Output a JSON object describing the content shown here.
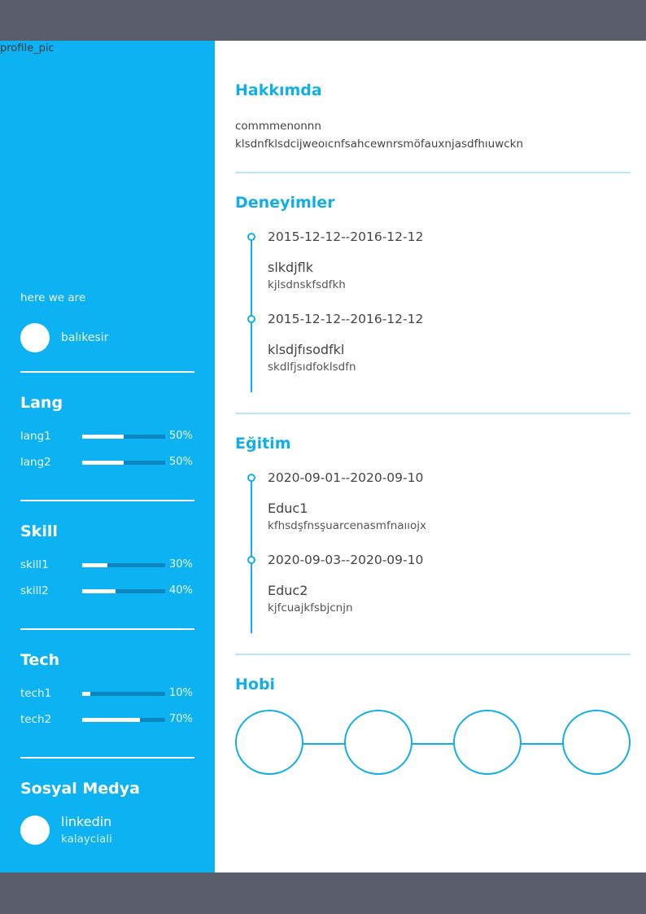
{
  "sidebar": {
    "profile_pic_label": "profile_pic",
    "tagline": "here we are",
    "location": "balıkesir",
    "lang": {
      "title": "Lang",
      "items": [
        {
          "name": "lang1",
          "percent_label": "50%",
          "percent": 50
        },
        {
          "name": "lang2",
          "percent_label": "50%",
          "percent": 50
        }
      ]
    },
    "skill": {
      "title": "Skill",
      "items": [
        {
          "name": "skill1",
          "percent_label": "30%",
          "percent": 30
        },
        {
          "name": "skill2",
          "percent_label": "40%",
          "percent": 40
        }
      ]
    },
    "tech": {
      "title": "Tech",
      "items": [
        {
          "name": "tech1",
          "percent_label": "10%",
          "percent": 10
        },
        {
          "name": "tech2",
          "percent_label": "70%",
          "percent": 70
        }
      ]
    },
    "social": {
      "title": "Sosyal Medya",
      "name": "linkedin",
      "handle": "kalayciali"
    }
  },
  "main": {
    "about": {
      "title": "Hakkımda",
      "line1": "commmenonnn",
      "line2": "klsdnfklsdcijweoıcnfsahcewnrsmöfauxnjasdfhıuwckn"
    },
    "experience": {
      "title": "Deneyimler",
      "items": [
        {
          "date": "2015-12-12--2016-12-12",
          "title": "slkdjflk",
          "desc": "kjlsdnskfsdfkh"
        },
        {
          "date": "2015-12-12--2016-12-12",
          "title": "klsdjfısodfkl",
          "desc": "skdlfjsıdfoklsdfn"
        }
      ]
    },
    "education": {
      "title": "Eğitim",
      "items": [
        {
          "date": "2020-09-01--2020-09-10",
          "title": "Educ1",
          "desc": "kfhsdşfnsşuarcenasmfnaııojx"
        },
        {
          "date": "2020-09-03--2020-09-10",
          "title": "Educ2",
          "desc": "kjfcuajkfsbjcnjn"
        }
      ]
    },
    "hobby": {
      "title": "Hobi",
      "count": 4
    }
  },
  "colors": {
    "accent": "#0cb2f1",
    "frame": "#5a5e6a",
    "divider": "#b8e8f7"
  }
}
